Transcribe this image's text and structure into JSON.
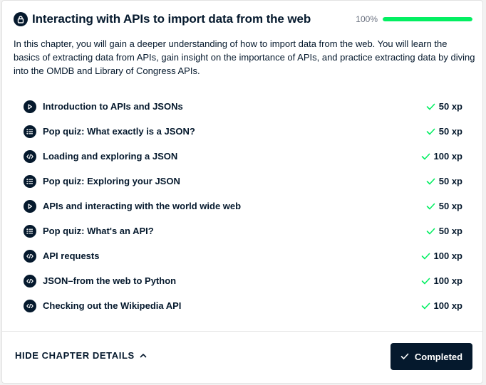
{
  "chapter": {
    "title": "Interacting with APIs to import data from the web",
    "progress_label": "100%",
    "progress_value": 1.0,
    "description": "In this chapter, you will gain a deeper understanding of how to import data from the web. You will learn the basics of extracting data from APIs, gain insight on the importance of APIs, and practice extracting data by diving into the OMDB and Library of Congress APIs."
  },
  "lessons": [
    {
      "title": "Introduction to APIs and JSONs",
      "xp": "50 xp",
      "icon": "play-icon"
    },
    {
      "title": "Pop quiz: What exactly is a JSON?",
      "xp": "50 xp",
      "icon": "list-icon"
    },
    {
      "title": "Loading and exploring a JSON",
      "xp": "100 xp",
      "icon": "code-icon"
    },
    {
      "title": "Pop quiz: Exploring your JSON",
      "xp": "50 xp",
      "icon": "list-icon"
    },
    {
      "title": "APIs and interacting with the world wide web",
      "xp": "50 xp",
      "icon": "play-icon"
    },
    {
      "title": "Pop quiz: What's an API?",
      "xp": "50 xp",
      "icon": "list-icon"
    },
    {
      "title": "API requests",
      "xp": "100 xp",
      "icon": "code-icon"
    },
    {
      "title": "JSON–from the web to Python",
      "xp": "100 xp",
      "icon": "code-icon"
    },
    {
      "title": "Checking out the Wikipedia API",
      "xp": "100 xp",
      "icon": "code-icon"
    }
  ],
  "footer": {
    "toggle_label": "HIDE CHAPTER DETAILS",
    "completed_label": "Completed"
  },
  "colors": {
    "navy": "#05192d",
    "progress_green": "#03ef62",
    "check_green": "#03ef62"
  }
}
